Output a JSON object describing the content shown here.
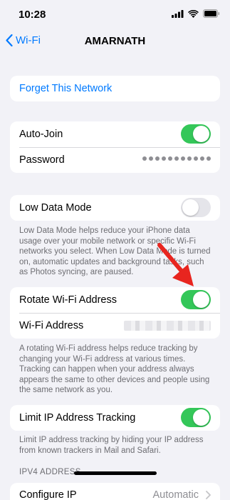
{
  "status_bar": {
    "time": "10:28"
  },
  "nav": {
    "back_label": "Wi-Fi",
    "title": "AMARNATH"
  },
  "forget": {
    "label": "Forget This Network"
  },
  "auto_join": {
    "label": "Auto-Join",
    "on": true
  },
  "password": {
    "label": "Password"
  },
  "low_data": {
    "label": "Low Data Mode",
    "on": false,
    "footer": "Low Data Mode helps reduce your iPhone data usage over your mobile network or specific Wi-Fi networks you select. When Low Data Mode is turned on, automatic updates and background tasks, such as Photos syncing, are paused."
  },
  "rotate": {
    "label": "Rotate Wi-Fi Address",
    "on": true,
    "address_label": "Wi-Fi Address",
    "footer": "A rotating Wi-Fi address helps reduce tracking by changing your Wi-Fi address at various times. Tracking can happen when your address always appears the same to other devices and people using the same network as you."
  },
  "limit_ip": {
    "label": "Limit IP Address Tracking",
    "on": true,
    "footer": "Limit IP address tracking by hiding your IP address from known trackers in Mail and Safari."
  },
  "ipv4": {
    "header": "IPV4 ADDRESS",
    "configure_label": "Configure IP",
    "configure_value": "Automatic"
  },
  "colors": {
    "accent": "#007aff",
    "toggle_on": "#34c759",
    "annotation": "#e8251f"
  }
}
